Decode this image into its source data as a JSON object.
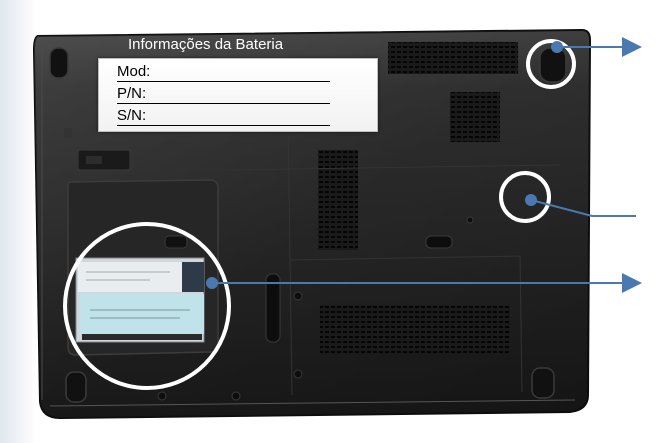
{
  "battery_info": {
    "title": "Informações da Bateria",
    "fields": [
      "Mod:",
      "P/N:",
      "S/N:"
    ]
  }
}
